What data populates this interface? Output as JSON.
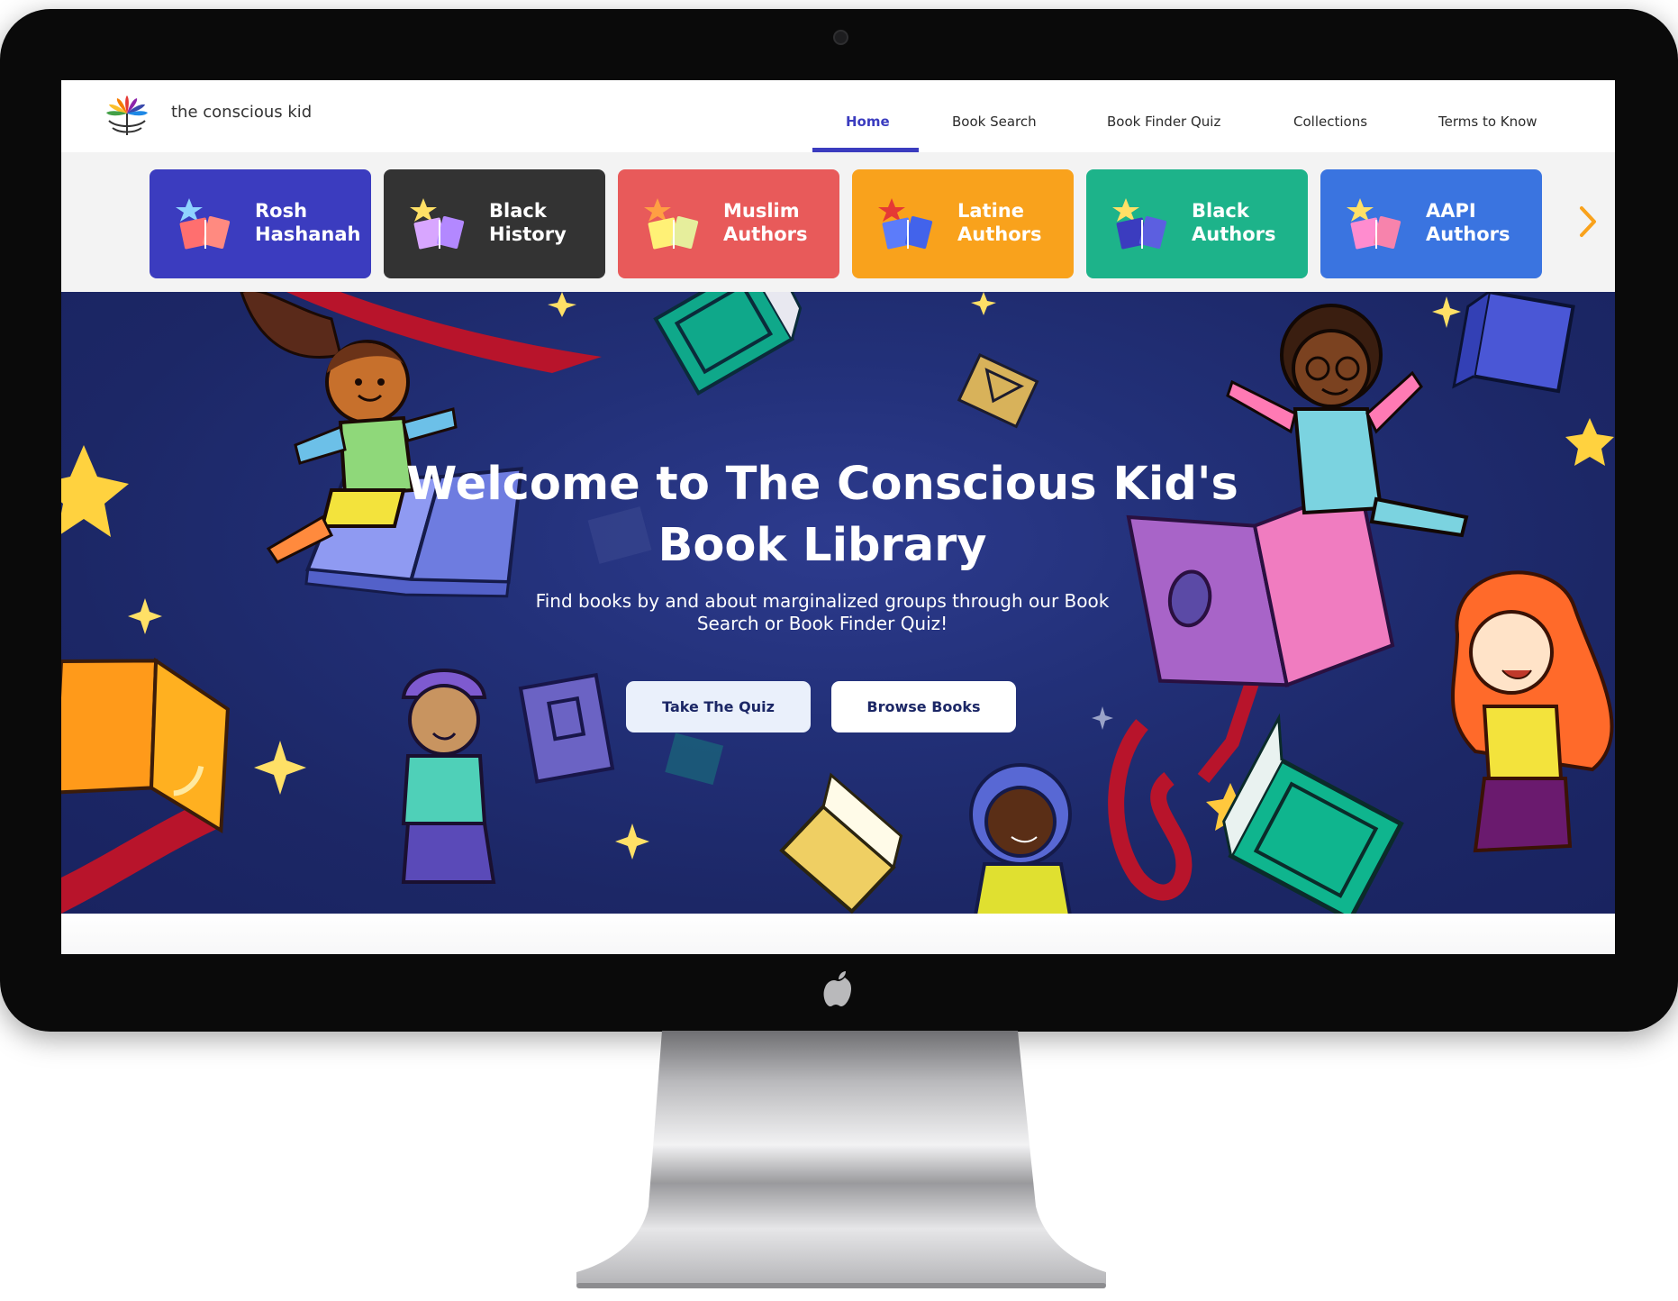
{
  "brand": {
    "name": "the conscious kid"
  },
  "nav": {
    "items": [
      {
        "label": "Home",
        "active": true
      },
      {
        "label": "Book Search",
        "active": false
      },
      {
        "label": "Book Finder Quiz",
        "active": false
      },
      {
        "label": "Collections",
        "active": false
      },
      {
        "label": "Terms to Know",
        "active": false
      }
    ],
    "accent": "#3b3cbf"
  },
  "collections": [
    {
      "label": "Rosh Hashanah",
      "color": "#3b3cbf",
      "icon": "books-star-icon"
    },
    {
      "label": "Black History",
      "color": "#333333",
      "icon": "books-star-icon"
    },
    {
      "label": "Muslim Authors",
      "color": "#e85a5a",
      "icon": "books-star-icon"
    },
    {
      "label": "Latine Authors",
      "color": "#f9a21c",
      "icon": "books-star-icon"
    },
    {
      "label": "Black Authors",
      "color": "#1db38a",
      "icon": "books-star-icon"
    },
    {
      "label": "AAPI Authors",
      "color": "#3a74e0",
      "icon": "books-star-icon"
    }
  ],
  "collections_next_icon": "chevron-right-icon",
  "hero": {
    "title": "Welcome to The Conscious Kid's Book Library",
    "subtitle": "Find books by and about marginalized groups through our Book Search or Book Finder Quiz!",
    "buttons": {
      "quiz": "Take The Quiz",
      "browse": "Browse Books"
    },
    "background_color": "#1c2766"
  },
  "device": {
    "logo": "apple-logo-icon"
  }
}
